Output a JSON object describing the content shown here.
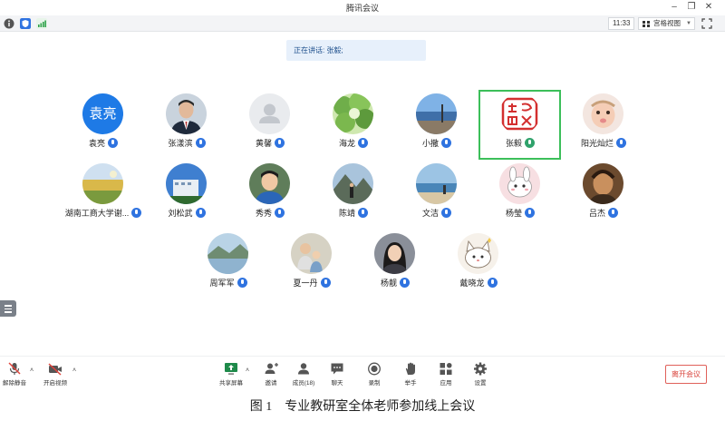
{
  "window": {
    "title": "腾讯会议"
  },
  "infobar": {
    "time": "11:33",
    "view_label": "宫格视图"
  },
  "speaking": {
    "label": "正在讲话: 张毅;"
  },
  "participants": [
    {
      "name": "袁亮",
      "avatar_text": "袁亮",
      "avatar_color": "#1e7ae6",
      "avatar_style": "text"
    },
    {
      "name": "张漾滨",
      "avatar_style": "photo-man-suit"
    },
    {
      "name": "黄馨",
      "avatar_style": "default"
    },
    {
      "name": "海龙",
      "avatar_style": "photo-trees"
    },
    {
      "name": "小撒",
      "avatar_style": "photo-sea"
    },
    {
      "name": "张毅",
      "avatar_style": "seal",
      "speaking": true
    },
    {
      "name": "阳光灿烂",
      "avatar_style": "photo-baby"
    },
    {
      "name": "湖南工商大学谢...",
      "avatar_style": "photo-field"
    },
    {
      "name": "刘松武",
      "avatar_style": "photo-building"
    },
    {
      "name": "秀秀",
      "avatar_style": "photo-boy"
    },
    {
      "name": "陈靖",
      "avatar_style": "photo-mountain-person"
    },
    {
      "name": "文洁",
      "avatar_style": "photo-beach"
    },
    {
      "name": "杨瑩",
      "avatar_style": "cartoon-bunny"
    },
    {
      "name": "吕杰",
      "avatar_style": "photo-painting"
    },
    {
      "name": "周军军",
      "avatar_style": "photo-lake"
    },
    {
      "name": "夏一丹",
      "avatar_style": "photo-family"
    },
    {
      "name": "杨靓",
      "avatar_style": "photo-woman"
    },
    {
      "name": "戴晓龙",
      "avatar_style": "cartoon-cat"
    }
  ],
  "toolbar": {
    "unmute": "解除静音",
    "start_video": "开启视频",
    "share_screen": "共享屏幕",
    "invite": "邀请",
    "members": "成员(18)",
    "chat": "聊天",
    "record": "录制",
    "raise_hand": "举手",
    "apps": "应用",
    "settings": "设置",
    "leave": "离开会议"
  },
  "caption": "图 1　专业教研室全体老师参加线上会议",
  "colors": {
    "accent": "#2f73e0",
    "speaking_border": "#3cbf5a",
    "leave": "#d9443c"
  }
}
